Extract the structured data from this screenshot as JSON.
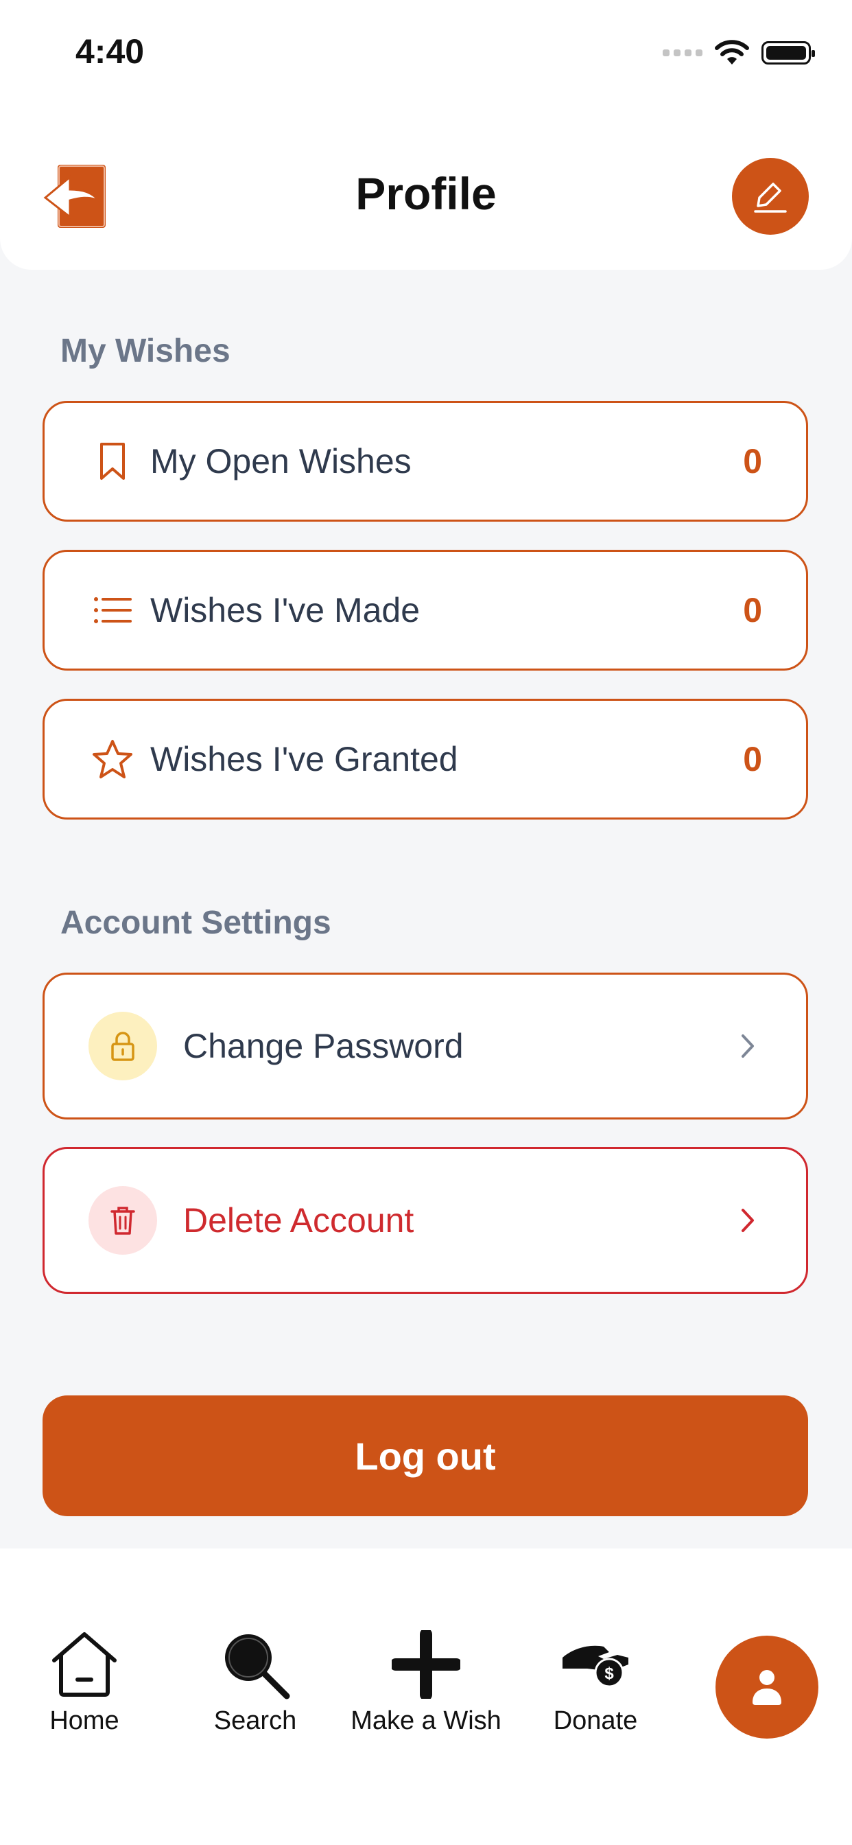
{
  "status_bar": {
    "time": "4:40"
  },
  "header": {
    "title": "Profile"
  },
  "wishes_section": {
    "title": "My Wishes",
    "items": [
      {
        "label": "My Open Wishes",
        "count": "0",
        "icon": "bookmark-icon"
      },
      {
        "label": "Wishes I've Made",
        "count": "0",
        "icon": "list-icon"
      },
      {
        "label": "Wishes I've Granted",
        "count": "0",
        "icon": "star-icon"
      }
    ]
  },
  "settings_section": {
    "title": "Account Settings",
    "items": [
      {
        "label": "Change Password",
        "icon": "lock-icon"
      },
      {
        "label": "Delete Account",
        "icon": "trash-icon"
      }
    ]
  },
  "logout_label": "Log out",
  "tab_bar": {
    "items": [
      {
        "label": "Home",
        "icon": "home-icon"
      },
      {
        "label": "Search",
        "icon": "search-icon"
      },
      {
        "label": "Make a Wish",
        "icon": "plus-icon"
      },
      {
        "label": "Donate",
        "icon": "donate-icon"
      },
      {
        "label": "",
        "icon": "profile-icon",
        "active": true
      }
    ]
  },
  "colors": {
    "accent": "#cd5317",
    "danger": "#d0282f",
    "background": "#f5f6f8",
    "text": "#2f3a4d",
    "section_title": "#6b7689"
  }
}
